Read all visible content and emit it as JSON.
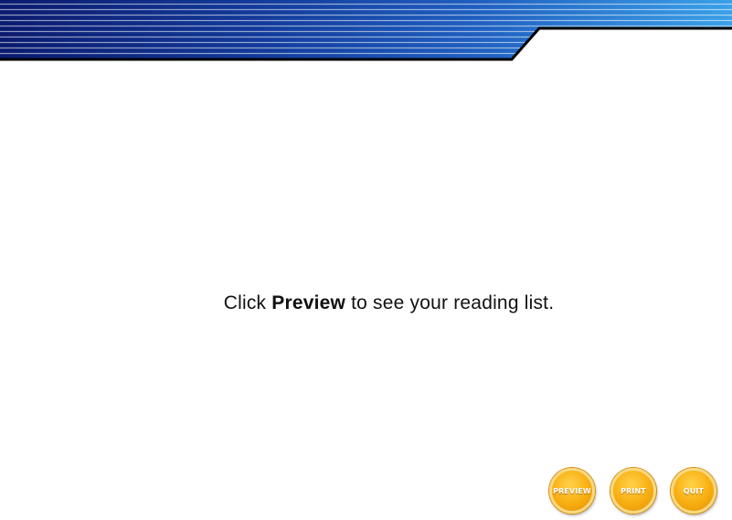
{
  "instruction": {
    "prefix": "Click ",
    "emphasis": "Preview",
    "suffix": " to see your reading list."
  },
  "buttons": {
    "preview": "PREVIEW",
    "print": "PRINT",
    "quit": "QUIT"
  },
  "colors": {
    "banner_dark": "#0a1a6e",
    "banner_mid": "#1f5fc0",
    "banner_light": "#3aa0e8",
    "button_gold": "#f8ae10",
    "button_rim": "#f9d880"
  }
}
